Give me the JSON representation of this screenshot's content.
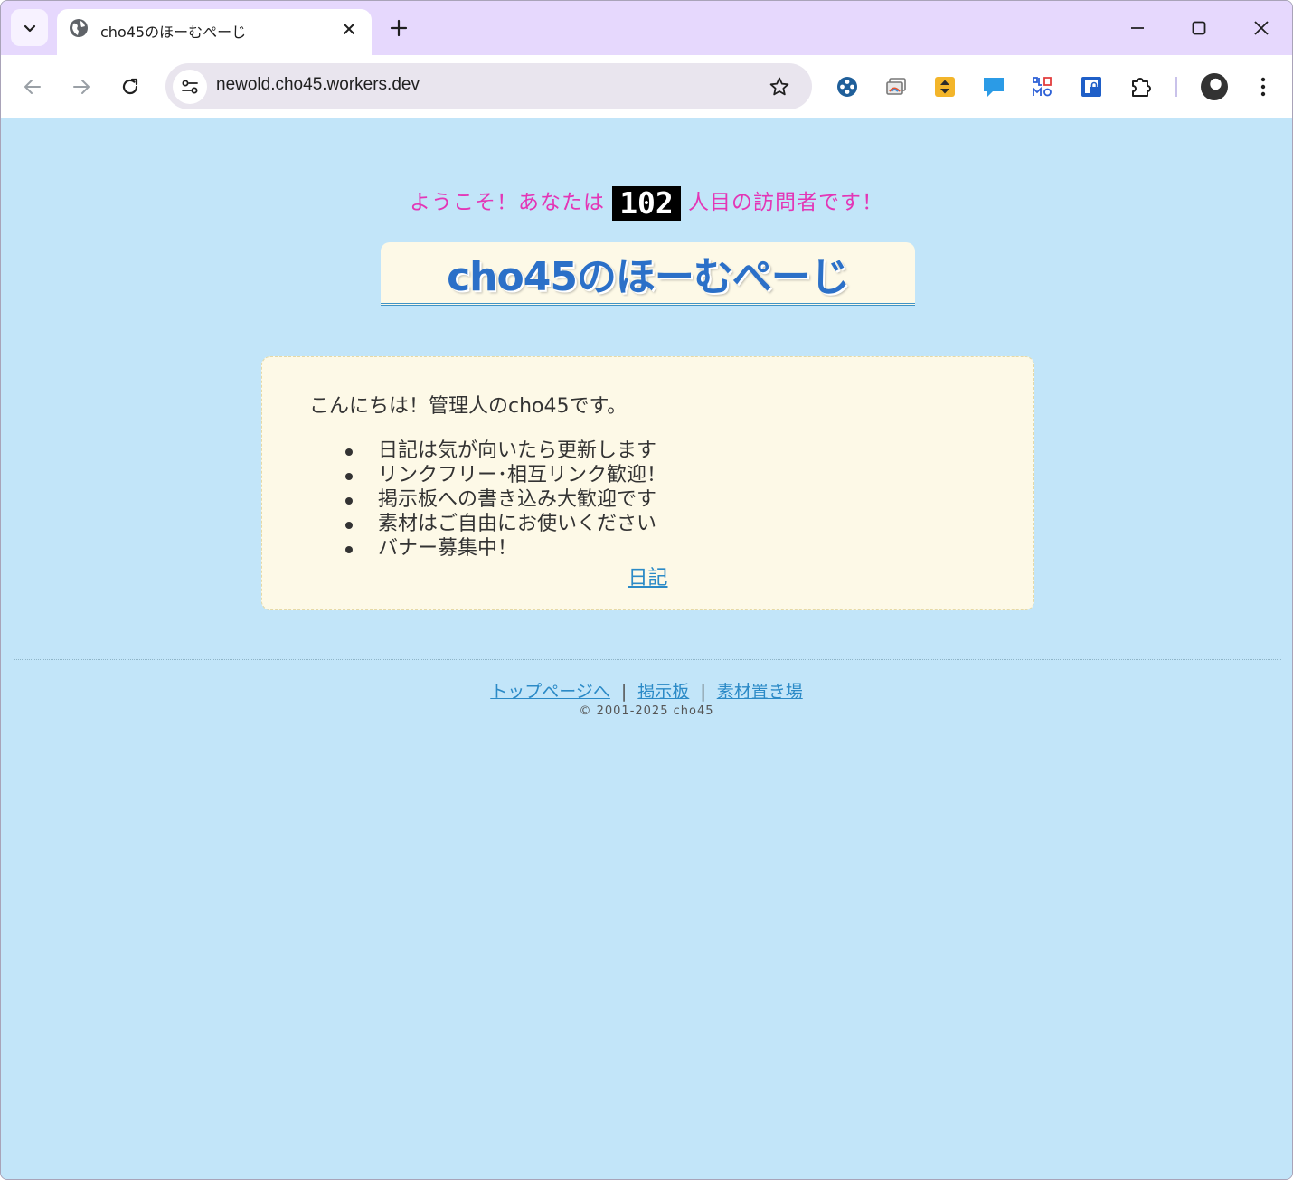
{
  "browser": {
    "tab_title": "cho45のほーむぺーじ",
    "url": "newold.cho45.workers.dev",
    "accent_color": "#e6d8fd"
  },
  "page": {
    "welcome_prefix": "ようこそ！あなたは",
    "visitor_count": "102",
    "welcome_suffix": "人目の訪問者です！",
    "site_title": "cho45のほーむぺーじ",
    "greeting": "こんにちは！管理人のcho45です。",
    "notes": [
      "日記は気が向いたら更新します",
      "リンクフリー･相互リンク歓迎！",
      "掲示板への書き込み大歓迎です",
      "素材はご自由にお使いください",
      "バナー募集中！"
    ],
    "diary_link": "日記",
    "footer_links": [
      "トップページへ",
      "掲示板",
      "素材置き場"
    ],
    "footer_separator": "|",
    "copyright": "© 2001-2025 cho45",
    "colors": {
      "background": "#c2e5f9",
      "welcome": "#e336b6",
      "title": "#2b70c8",
      "link": "#2b8ac7",
      "box": "#fdf9e7"
    }
  }
}
